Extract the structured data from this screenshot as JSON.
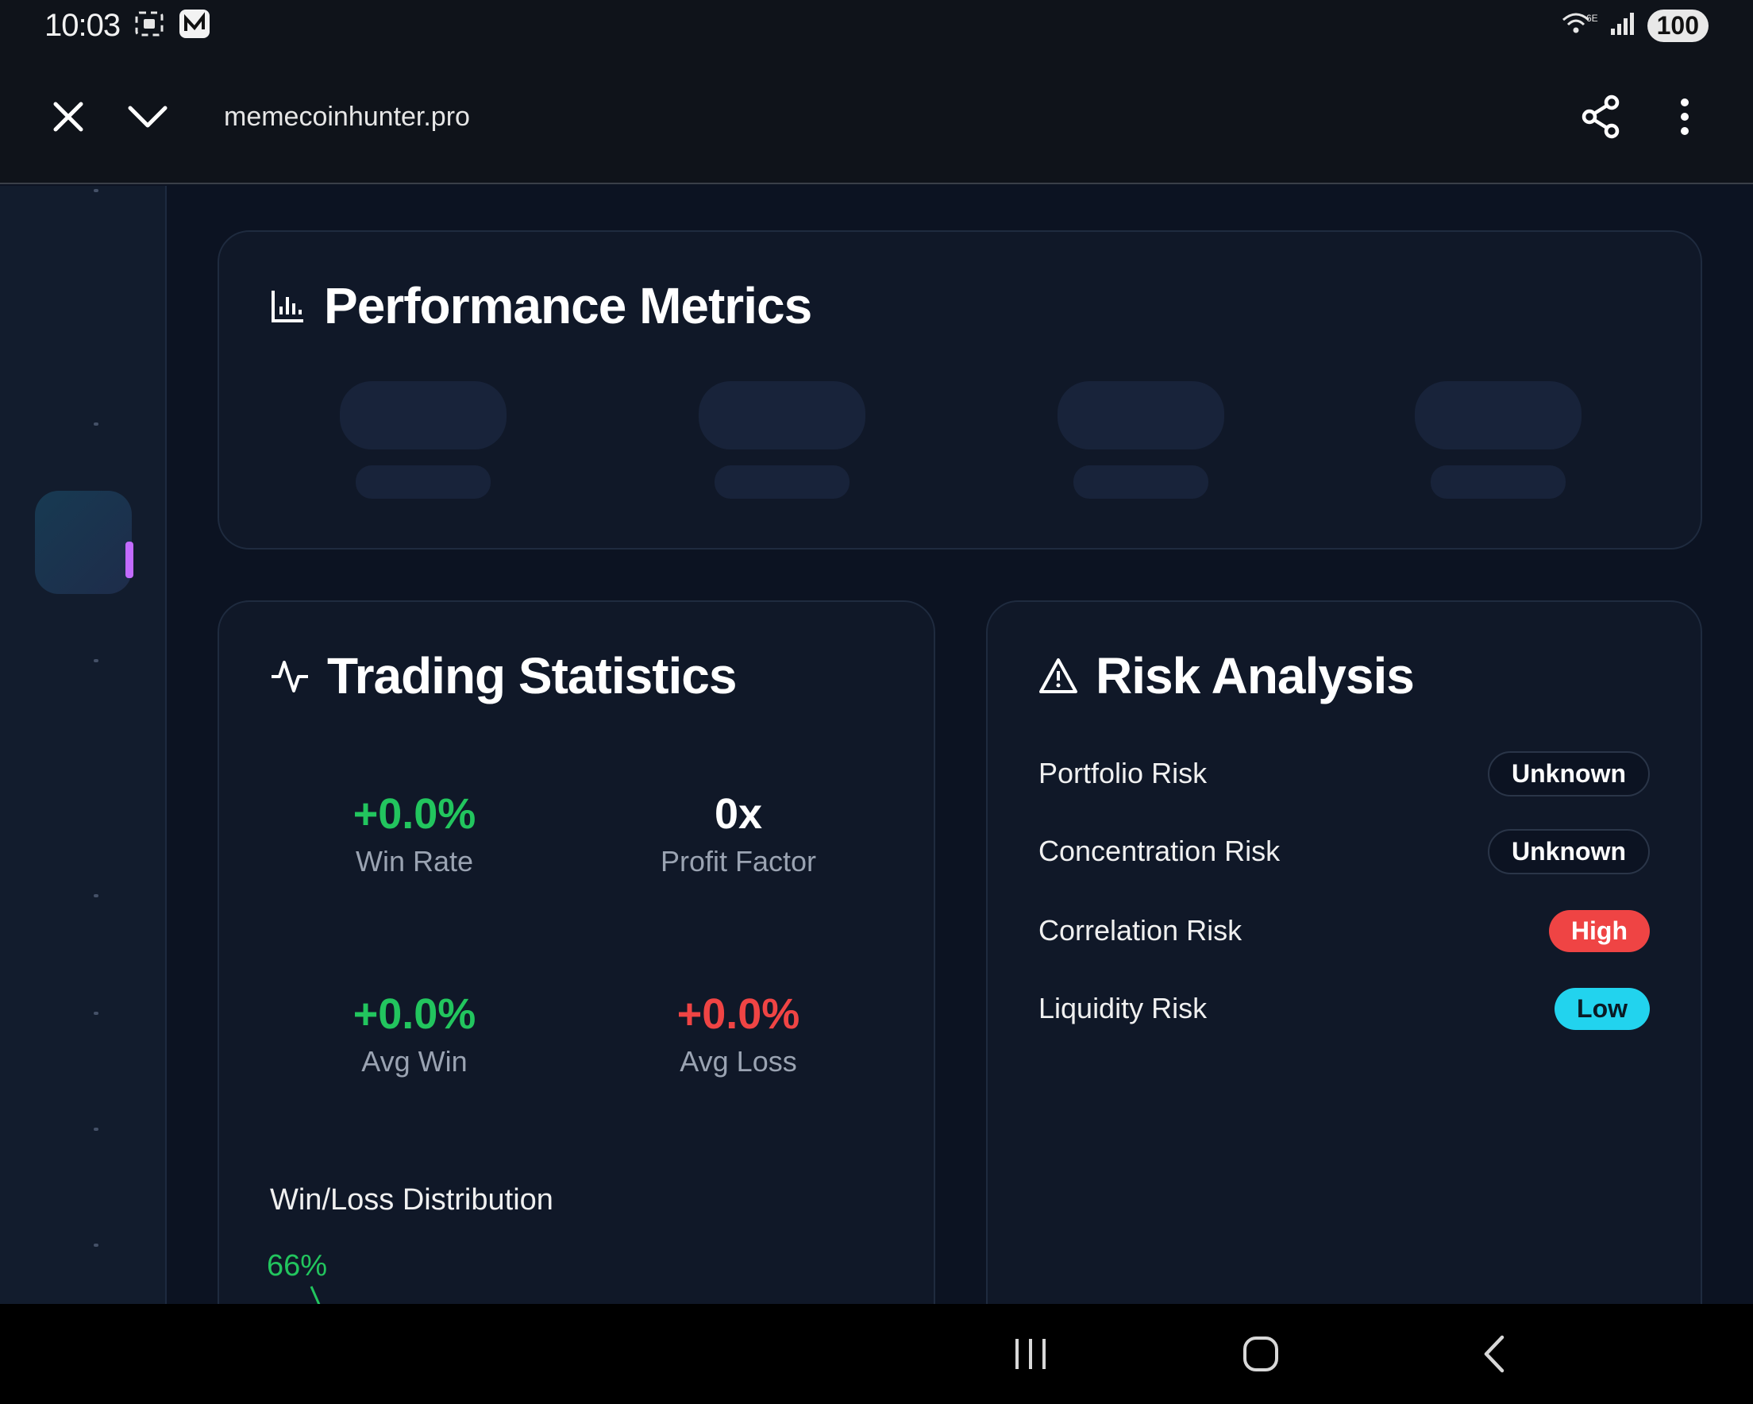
{
  "status_bar": {
    "time": "10:03",
    "battery": "100",
    "network": "6E"
  },
  "browser": {
    "url": "memecoinhunter.pro"
  },
  "performance": {
    "title": "Performance Metrics"
  },
  "trading": {
    "title": "Trading Statistics",
    "stats": [
      {
        "value": "+0.0%",
        "label": "Win Rate",
        "color": "#22c55e"
      },
      {
        "value": "0x",
        "label": "Profit Factor",
        "color": "#ffffff"
      },
      {
        "value": "+0.0%",
        "label": "Avg Win",
        "color": "#22c55e"
      },
      {
        "value": "+0.0%",
        "label": "Avg Loss",
        "color": "#ef4444"
      }
    ],
    "distribution_title": "Win/Loss Distribution",
    "distribution_label": "66%"
  },
  "risk": {
    "title": "Risk Analysis",
    "rows": [
      {
        "label": "Portfolio Risk",
        "badge": "Unknown"
      },
      {
        "label": "Concentration Risk",
        "badge": "Unknown"
      },
      {
        "label": "Correlation Risk",
        "badge": "High"
      },
      {
        "label": "Liquidity Risk",
        "badge": "Low"
      }
    ]
  },
  "colors": {
    "accent_green": "#22c55e",
    "accent_red": "#ef4444",
    "accent_cyan": "#22d3ee",
    "accent_purple": "#c26bff"
  }
}
